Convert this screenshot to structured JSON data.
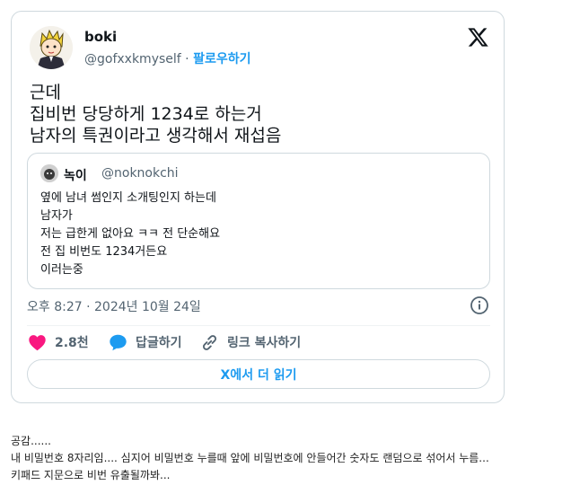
{
  "tweet": {
    "author_name": "boki",
    "author_handle": "@gofxxkmyself",
    "separator": " · ",
    "follow_label": "팔로우하기",
    "text_lines": [
      "근데",
      "집비번 당당하게 1234로 하는거",
      "남자의 특권이라고 생각해서 재섭음"
    ],
    "quote": {
      "name": "녹이",
      "handle": "@noknokchi",
      "lines": [
        "옆에 남녀 썸인지 소개팅인지 하는데",
        "남자가",
        "저는 급한게 없아요 ㅋㅋ 전 단순해요",
        "전 집 비번도 1234거든요",
        "이러는중"
      ]
    },
    "timestamp": "오후 8:27 · 2024년 10월 24일",
    "actions": {
      "likes": "2.8천",
      "reply": "답글하기",
      "copy_link": "링크 복사하기"
    },
    "read_more": "X에서 더 읽기"
  },
  "post_body": [
    "공감......",
    "내 비밀번호 8자리임.... 심지어 비밀번호 누를때 앞에 비밀번호에 안들어간 숫자도 랜덤으로 섞어서 누름...",
    "키패드 지문으로 비번 유출될까봐..."
  ],
  "colors": {
    "accent": "#1d9bf0",
    "like": "#f91880",
    "muted": "#536471",
    "border": "#cfd9de"
  },
  "icons": [
    "x-logo-icon",
    "info-icon",
    "heart-icon",
    "reply-bubble-icon",
    "link-icon"
  ]
}
